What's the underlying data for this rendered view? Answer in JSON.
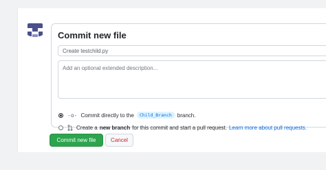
{
  "commit_form": {
    "title": "Commit new file",
    "summary_value": "Create testchild.py",
    "description_placeholder": "Add an optional extended description...",
    "option_direct": {
      "prefix": "Commit directly to the",
      "branch": "Child_Branch",
      "suffix": "branch.",
      "checked": true
    },
    "option_new_branch": {
      "prefix": "Create a",
      "bold": "new branch",
      "middle": "for this commit and start a pull request.",
      "link": "Learn more about pull requests.",
      "checked": false
    },
    "commit_button": "Commit new file",
    "cancel_button": "Cancel"
  },
  "colors": {
    "accent_green": "#2da44e",
    "link_blue": "#0969da",
    "cancel_red": "#cf222e",
    "avatar_purple": "#4b4f8c"
  },
  "icons": {
    "avatar": "identicon-avatar",
    "commit": "git-commit-icon",
    "pull_request": "git-pull-request-icon"
  }
}
